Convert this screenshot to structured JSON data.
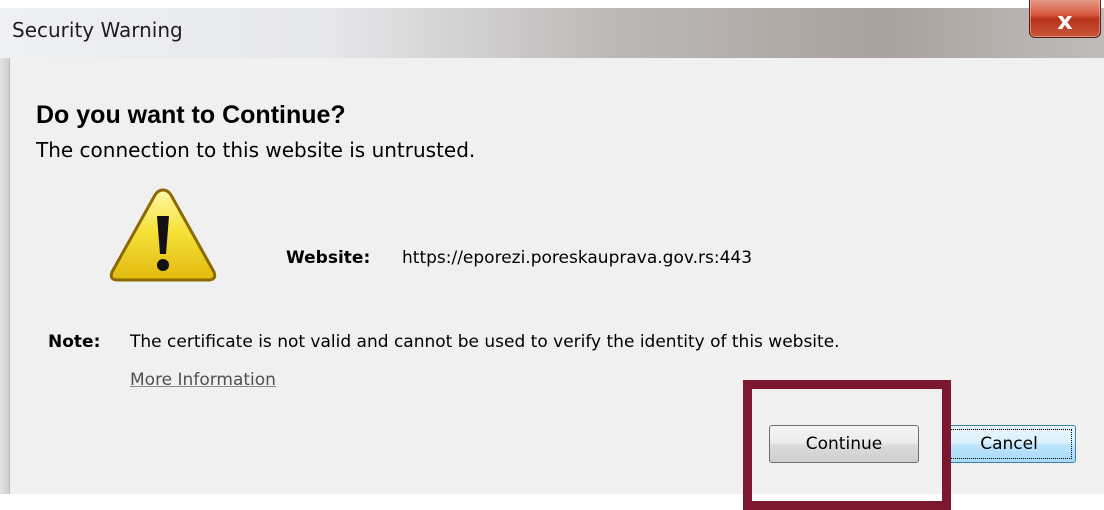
{
  "window": {
    "title": "Security Warning",
    "close_glyph": "x",
    "close_icon": "close-icon"
  },
  "dialog": {
    "heading": "Do you want to Continue?",
    "subheading": "The connection to this website is untrusted.",
    "warning_icon": "warning-triangle-icon",
    "website_label": "Website:",
    "website_value": "https://eporezi.poreskauprava.gov.rs:443",
    "note_label": "Note:",
    "note_text": "The certificate is not valid and cannot be used to verify the identity of this website.",
    "more_info_link": "More Information"
  },
  "buttons": {
    "continue_label": "Continue",
    "cancel_label": "Cancel"
  },
  "colors": {
    "highlight_box": "#7b1830",
    "close_button": "#c9442a",
    "warning_yellow": "#f6e23a",
    "dialog_background": "#f0f0f0"
  }
}
